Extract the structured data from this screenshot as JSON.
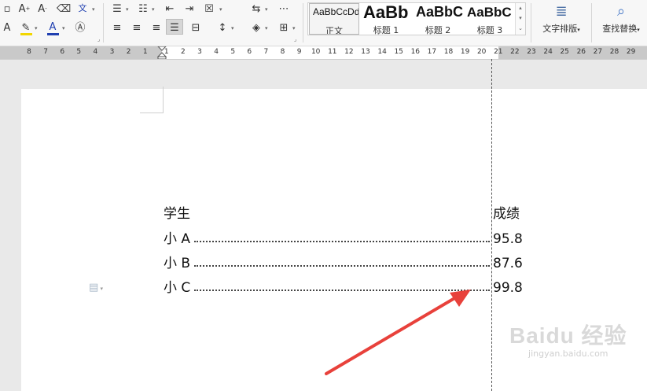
{
  "toolbar": {
    "styles": [
      {
        "preview": "AaBbCcDd",
        "label": "正文"
      },
      {
        "preview": "AaBb",
        "label": "标题 1"
      },
      {
        "preview": "AaBbC",
        "label": "标题 2"
      },
      {
        "preview": "AaBbC",
        "label": "标题 3"
      }
    ],
    "text_layout_label": "文字排版",
    "find_replace_label": "查找替换",
    "icons": {
      "font_size_up": "A",
      "font_size_down": "A",
      "clear_format": "eraser",
      "phonetic": "wén"
    }
  },
  "ruler": {
    "numbers": [
      "8",
      "7",
      "6",
      "5",
      "4",
      "3",
      "2",
      "1",
      "1",
      "2",
      "3",
      "4",
      "5",
      "6",
      "7",
      "8",
      "9",
      "10",
      "11",
      "12",
      "13",
      "14",
      "15",
      "16",
      "17",
      "18",
      "19",
      "20",
      "21",
      "22",
      "23",
      "24",
      "25",
      "26",
      "27",
      "28",
      "29"
    ]
  },
  "document": {
    "header_left": "学生",
    "header_right": "成绩",
    "rows": [
      {
        "name": "小 A",
        "score": "95.8"
      },
      {
        "name": "小 B",
        "score": "87.6"
      },
      {
        "name": "小 C",
        "score": "99.8"
      }
    ]
  },
  "watermark": {
    "main": "Baidu 经验",
    "sub": "jingyan.baidu.com"
  },
  "colors": {
    "arrow": "#e8413b",
    "highlight": "#f2d600",
    "font_color": "#1f3fb0"
  }
}
